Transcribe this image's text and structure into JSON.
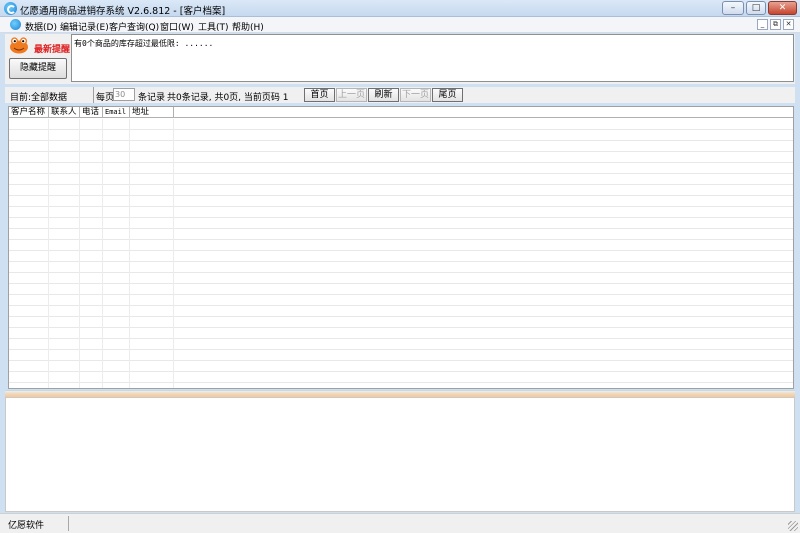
{
  "window": {
    "title": "亿愿通用商品进销存系统 V2.6.812 - [客户档案]"
  },
  "menu": {
    "items": [
      "数据(D)",
      "编辑记录(E)",
      "客户查询(Q)",
      "窗口(W)",
      "工具(T)",
      "帮助(H)"
    ]
  },
  "alert": {
    "title": "最新提醒:",
    "hide_button": "隐藏提醒",
    "message": "有0个商品的库存超过最低限: ......"
  },
  "pager": {
    "current_label": "目前:全部数据",
    "per_page_label": "每页",
    "per_page_value": "30",
    "records_label": "条记录",
    "summary": "共0条记录, 共0页, 当前页码 1",
    "buttons": {
      "first": "首页",
      "prev": "上一页",
      "refresh": "刷新",
      "next": "下一页",
      "last": "尾页"
    }
  },
  "table": {
    "columns": [
      "客户名称",
      "联系人",
      "电话",
      "Email",
      "地址"
    ],
    "rows": []
  },
  "status": {
    "text": "亿愿软件"
  },
  "colors": {
    "alert_title": "#e02020",
    "splitter": "#f4c89a",
    "title_bar": "#c6d9ef"
  }
}
